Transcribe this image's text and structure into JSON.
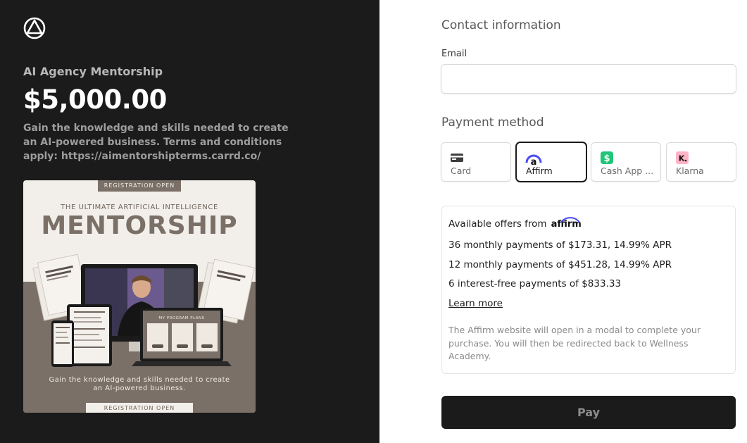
{
  "product": {
    "name": "AI Agency Mentorship",
    "price": "$5,000.00",
    "description": "Gain the knowledge and skills needed to create an AI-powered business. Terms and conditions apply: https://aimentorshipterms.carrd.co/"
  },
  "promo_image": {
    "badge_top": "REGISTRATION OPEN",
    "subtitle": "THE ULTIMATE ARTIFICIAL INTELLIGENCE",
    "title": "MENTORSHIP",
    "screen_heading": "MY PROGRAM PLANS",
    "caption": "Gain the knowledge and skills needed to create an AI-powered business.",
    "badge_bottom": "REGISTRATION OPEN"
  },
  "contact": {
    "heading": "Contact information",
    "email_label": "Email",
    "email_value": "",
    "email_placeholder": ""
  },
  "payment": {
    "heading": "Payment method",
    "methods": [
      {
        "label": "Card",
        "icon": "card-icon"
      },
      {
        "label": "Affirm",
        "icon": "affirm-icon",
        "selected": true
      },
      {
        "label": "Cash App ...",
        "icon": "cash-app-icon"
      },
      {
        "label": "Klarna",
        "icon": "klarna-icon"
      }
    ]
  },
  "offers": {
    "intro": "Available offers from",
    "brand": "affirm",
    "items": [
      "36 monthly payments of $173.31, 14.99% APR",
      "12 monthly payments of $451.28, 14.99% APR",
      "6 interest-free payments of $833.33"
    ],
    "learn_more": "Learn more",
    "note": "The Affirm website will open in a modal to complete your purchase. You will then be redirected back to Wellness Academy."
  },
  "pay_button": "Pay",
  "colors": {
    "left_bg": "#1b1b1b",
    "accent": "#1b1b1b",
    "promo_brown": "#7b7067",
    "promo_cream": "#f2efea",
    "cash_app_green": "#1ec677",
    "klarna_pink": "#ffb3c7",
    "affirm_blue": "#4a4af4"
  }
}
